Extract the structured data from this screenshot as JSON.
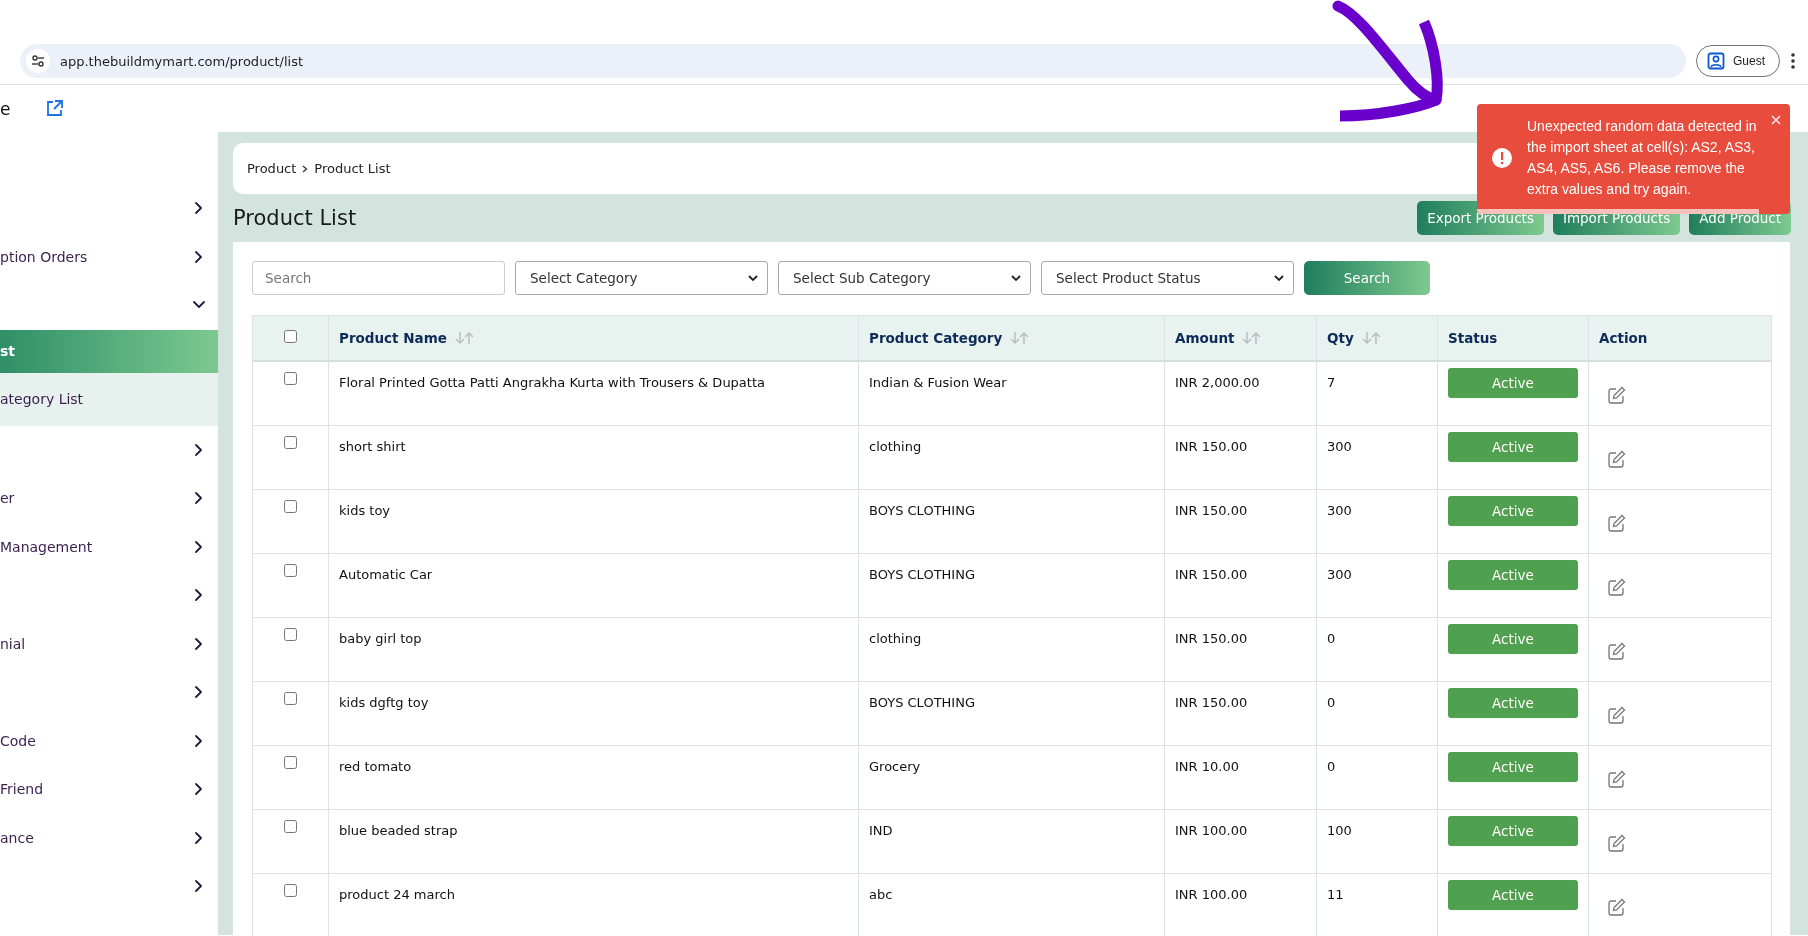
{
  "browser": {
    "url": "app.thebuildmymart.com/product/list",
    "profile_label": "Guest"
  },
  "header": {
    "brand_text": "e"
  },
  "sidebar": {
    "items": [
      {
        "expanded": false
      },
      {
        "label": "ption Orders",
        "expanded": false
      },
      {
        "expanded": true,
        "children": [
          {
            "label": "st",
            "selected": true
          },
          {
            "label": "ategory List",
            "selected": false
          }
        ]
      },
      {
        "expanded": false
      },
      {
        "label": "er",
        "expanded": false
      },
      {
        "label": "Management",
        "expanded": false
      },
      {
        "expanded": false
      },
      {
        "label": "nial",
        "expanded": false
      },
      {
        "expanded": false
      },
      {
        "label": "Code",
        "expanded": false
      },
      {
        "label": "Friend",
        "expanded": false
      },
      {
        "label": "ance",
        "expanded": false
      },
      {
        "expanded": false
      }
    ]
  },
  "breadcrumb": [
    "Product",
    "Product List"
  ],
  "page_title": "Product List",
  "actions": [
    "Export Products",
    "Import Products",
    "Add Product"
  ],
  "filters": {
    "search_placeholder": "Search",
    "selects": [
      "Select Category",
      "Select Sub Category",
      "Select Product Status"
    ],
    "button": "Search"
  },
  "table": {
    "header_checkbox": {
      "checked": false
    },
    "columns": [
      {
        "label": "Product Name",
        "sortable": true
      },
      {
        "label": "Product Category",
        "sortable": true
      },
      {
        "label": "Amount",
        "sortable": true
      },
      {
        "label": "Qty",
        "sortable": true
      },
      {
        "label": "Status",
        "sortable": false
      },
      {
        "label": "Action",
        "sortable": false
      }
    ],
    "rows": [
      {
        "checked": false,
        "name": "Floral Printed Gotta Patti Angrakha Kurta with Trousers & Dupatta",
        "category": "Indian & Fusion Wear",
        "amount": "INR 2,000.00",
        "qty": "7",
        "status": "Active"
      },
      {
        "checked": false,
        "name": "short shirt",
        "category": "clothing",
        "amount": "INR 150.00",
        "qty": "300",
        "status": "Active"
      },
      {
        "checked": false,
        "name": "kids toy",
        "category": "BOYS CLOTHING",
        "amount": "INR 150.00",
        "qty": "300",
        "status": "Active"
      },
      {
        "checked": false,
        "name": "Automatic Car",
        "category": "BOYS CLOTHING",
        "amount": "INR 150.00",
        "qty": "300",
        "status": "Active"
      },
      {
        "checked": false,
        "name": "baby girl top",
        "category": "clothing",
        "amount": "INR 150.00",
        "qty": "0",
        "status": "Active"
      },
      {
        "checked": false,
        "name": "kids dgftg toy",
        "category": "BOYS CLOTHING",
        "amount": "INR 150.00",
        "qty": "0",
        "status": "Active"
      },
      {
        "checked": false,
        "name": "red tomato",
        "category": "Grocery",
        "amount": "INR 10.00",
        "qty": "0",
        "status": "Active"
      },
      {
        "checked": false,
        "name": "blue beaded strap",
        "category": "IND",
        "amount": "INR 100.00",
        "qty": "100",
        "status": "Active"
      },
      {
        "checked": false,
        "name": "product 24 march",
        "category": "abc",
        "amount": "INR 100.00",
        "qty": "11",
        "status": "Active"
      }
    ]
  },
  "toast": {
    "kind": "error",
    "message": "Unexpected random data detected in the import sheet at cell(s): AS2, AS3, AS4, AS5, AS6. Please remove the extra values and try again.",
    "progress": {
      "level": 0.9
    }
  },
  "annotation": {
    "kind": "arrow"
  }
}
